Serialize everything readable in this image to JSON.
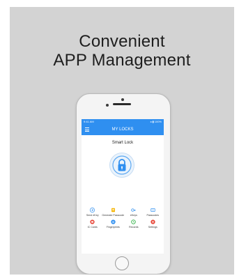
{
  "headline": {
    "line1": "Convenient",
    "line2": "APP Management"
  },
  "phone": {
    "status_bar": {
      "left": "9:41 AM",
      "right": "◂ ▮ 100%"
    },
    "app_bar": {
      "title": "MY LOCKS",
      "menu_icon": "hamburger-icon"
    },
    "lock": {
      "name": "Smart Lock",
      "icon": "padlock-icon"
    },
    "actions": [
      {
        "label": "Send eKey",
        "icon": "send-ekey-icon",
        "color": "#2f8ff0"
      },
      {
        "label": "Generate Passcode",
        "icon": "passcode-icon",
        "color": "#f5b400"
      },
      {
        "label": "eKeys",
        "icon": "ekeys-icon",
        "color": "#2f8ff0"
      },
      {
        "label": "Passcodes",
        "icon": "passcodes-icon",
        "color": "#2f8ff0"
      },
      {
        "label": "IC Cards",
        "icon": "ic-card-icon",
        "color": "#e84a3c"
      },
      {
        "label": "Fingerprints",
        "icon": "fingerprint-icon",
        "color": "#2f8ff0"
      },
      {
        "label": "Records",
        "icon": "records-icon",
        "color": "#35b34a"
      },
      {
        "label": "Settings",
        "icon": "settings-icon",
        "color": "#e84a3c"
      }
    ]
  }
}
